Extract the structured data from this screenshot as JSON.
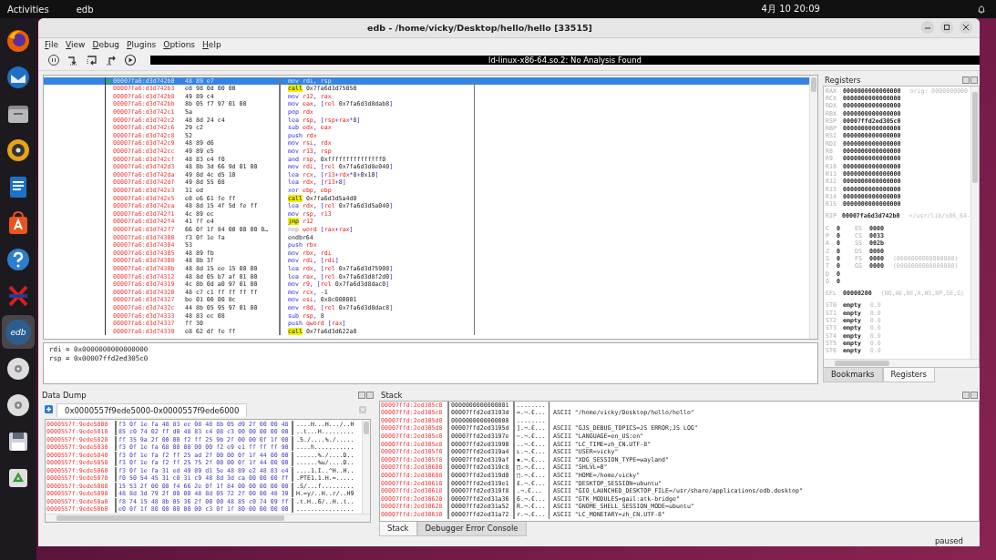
{
  "topbar": {
    "activities": "Activities",
    "app": "edb",
    "clock": "4月 10 20:09"
  },
  "dock": [
    {
      "kind": "browser",
      "active": false
    },
    {
      "kind": "mail",
      "active": false
    },
    {
      "kind": "files",
      "active": false
    },
    {
      "kind": "music",
      "active": false
    },
    {
      "kind": "writer",
      "active": false
    },
    {
      "kind": "store",
      "active": false
    },
    {
      "kind": "help",
      "active": false
    },
    {
      "kind": "cross",
      "active": false
    },
    {
      "kind": "edb",
      "active": true,
      "label": "edb"
    },
    {
      "kind": "disc",
      "active": false
    },
    {
      "kind": "disc",
      "active": false
    },
    {
      "kind": "save",
      "active": false
    },
    {
      "kind": "trash",
      "active": false
    }
  ],
  "window": {
    "title": "edb - /home/vicky/Desktop/hello/hello [33515]"
  },
  "menu": [
    "File",
    "View",
    "Debug",
    "Plugins",
    "Options",
    "Help"
  ],
  "toolbar": {
    "tools": [
      {
        "kind": "pause"
      },
      {
        "kind": "step-into"
      },
      {
        "kind": "step-over"
      },
      {
        "kind": "step-out"
      },
      {
        "kind": "run"
      }
    ],
    "status": "ld-linux-x86-64.so.2: No Analysis Found"
  },
  "disassembly": {
    "rows": [
      {
        "address": "00007fa6:d3d742b0",
        "bytes": "48 89 e7",
        "mnemonic": "mov",
        "operands": "rdi, rsp",
        "kind": "normal",
        "selected": true
      },
      {
        "address": "00007fa6:d3d742b3",
        "bytes": "e8 98 0d 00 00",
        "mnemonic": "call",
        "operands": "0x7fa6d3d75050",
        "kind": "call",
        "selected": false
      },
      {
        "address": "00007fa6:d3d742b8",
        "bytes": "49 89 c4",
        "mnemonic": "mov",
        "operands": "r12, rax",
        "kind": "normal",
        "selected": false
      },
      {
        "address": "00007fa6:d3d742bb",
        "bytes": "8b 05 f7 97 01 00",
        "mnemonic": "mov",
        "operands": "eax, [rel 0x7fa6d3d8dab8]",
        "kind": "normal",
        "selected": false
      },
      {
        "address": "00007fa6:d3d742c1",
        "bytes": "5a",
        "mnemonic": "pop",
        "operands": "rdx",
        "kind": "normal",
        "selected": false
      },
      {
        "address": "00007fa6:d3d742c2",
        "bytes": "48 8d 24 c4",
        "mnemonic": "lea",
        "operands": "rsp, [rsp+rax*8]",
        "kind": "normal",
        "selected": false
      },
      {
        "address": "00007fa6:d3d742c6",
        "bytes": "29 c2",
        "mnemonic": "sub",
        "operands": "edx, eax",
        "kind": "normal",
        "selected": false
      },
      {
        "address": "00007fa6:d3d742c8",
        "bytes": "52",
        "mnemonic": "push",
        "operands": "rdx",
        "kind": "normal",
        "selected": false
      },
      {
        "address": "00007fa6:d3d742c9",
        "bytes": "48 89 d6",
        "mnemonic": "mov",
        "operands": "rsi, rdx",
        "kind": "normal",
        "selected": false
      },
      {
        "address": "00007fa6:d3d742cc",
        "bytes": "49 89 e5",
        "mnemonic": "mov",
        "operands": "r13, rsp",
        "kind": "normal",
        "selected": false
      },
      {
        "address": "00007fa6:d3d742cf",
        "bytes": "48 83 e4 f0",
        "mnemonic": "and",
        "operands": "rsp, 0xfffffffffffffff0",
        "kind": "normal",
        "selected": false
      },
      {
        "address": "00007fa6:d3d742d3",
        "bytes": "48 8b 3d 66 9d 01 00",
        "mnemonic": "mov",
        "operands": "rdi, [rel 0x7fa6d3d8e040]",
        "kind": "normal",
        "selected": false
      },
      {
        "address": "00007fa6:d3d742da",
        "bytes": "49 8d 4c d5 10",
        "mnemonic": "lea",
        "operands": "rcx, [r13+rdx*8+0x10]",
        "kind": "normal",
        "selected": false
      },
      {
        "address": "00007fa6:d3d742df",
        "bytes": "49 8d 55 08",
        "mnemonic": "lea",
        "operands": "rdx, [r13+8]",
        "kind": "normal",
        "selected": false
      },
      {
        "address": "00007fa6:d3d742e3",
        "bytes": "31 ed",
        "mnemonic": "xor",
        "operands": "ebp, ebp",
        "kind": "normal",
        "selected": false
      },
      {
        "address": "00007fa6:d3d742e5",
        "bytes": "e8 e6 61 fe ff",
        "mnemonic": "call",
        "operands": "0x7fa6d3d5a4d0",
        "kind": "call",
        "selected": false
      },
      {
        "address": "00007fa6:d3d742ea",
        "bytes": "48 8d 15 4f 5d fe ff",
        "mnemonic": "lea",
        "operands": "rdx, [rel 0x7fa6d3d5a040]",
        "kind": "normal",
        "selected": false
      },
      {
        "address": "00007fa6:d3d742f1",
        "bytes": "4c 89 ec",
        "mnemonic": "mov",
        "operands": "rsp, r13",
        "kind": "normal",
        "selected": false
      },
      {
        "address": "00007fa6:d3d742f4",
        "bytes": "41 ff e4",
        "mnemonic": "jmp",
        "operands": "r12",
        "kind": "call",
        "selected": false
      },
      {
        "address": "00007fa6:d3d742f7",
        "bytes": "66 0f 1f 84 00 00 00 0…",
        "mnemonic": "nop",
        "operands": "word [rax+rax]",
        "kind": "nop",
        "selected": false
      },
      {
        "address": "00007fa6:d3d74300",
        "bytes": "f3 0f 1e fa",
        "mnemonic": "endbr64",
        "operands": "",
        "kind": "plain",
        "selected": false
      },
      {
        "address": "00007fa6:d3d74304",
        "bytes": "53",
        "mnemonic": "push",
        "operands": "rbx",
        "kind": "normal",
        "selected": false
      },
      {
        "address": "00007fa6:d3d74305",
        "bytes": "48 89 fb",
        "mnemonic": "mov",
        "operands": "rbx, rdi",
        "kind": "normal",
        "selected": false
      },
      {
        "address": "00007fa6:d3d74308",
        "bytes": "48 8b 3f",
        "mnemonic": "mov",
        "operands": "rdi, [rdi]",
        "kind": "normal",
        "selected": false
      },
      {
        "address": "00007fa6:d3d7430b",
        "bytes": "48 8d 15 ee 15 00 00",
        "mnemonic": "lea",
        "operands": "rdx, [rel 0x7fa6d3d75900]",
        "kind": "normal",
        "selected": false
      },
      {
        "address": "00007fa6:d3d74312",
        "bytes": "48 8d 05 b7 af 01 00",
        "mnemonic": "lea",
        "operands": "rax, [rel 0x7fa6d3d8f2d0]",
        "kind": "normal",
        "selected": false
      },
      {
        "address": "00007fa6:d3d74319",
        "bytes": "4c 8b 0d a0 97 01 00",
        "mnemonic": "mov",
        "operands": "r9, [rel 0x7fa6d3d8dac0]",
        "kind": "normal",
        "selected": false
      },
      {
        "address": "00007fa6:d3d74320",
        "bytes": "48 c7 c1 ff ff ff ff",
        "mnemonic": "mov",
        "operands": "rcx, -1",
        "kind": "normal",
        "selected": false
      },
      {
        "address": "00007fa6:d3d74327",
        "bytes": "be 01 00 00 8c",
        "mnemonic": "mov",
        "operands": "esi, 0x8c000001",
        "kind": "normal",
        "selected": false
      },
      {
        "address": "00007fa6:d3d7432c",
        "bytes": "44 8b 05 95 97 01 00",
        "mnemonic": "mov",
        "operands": "r8d, [rel 0x7fa6d3d8dac8]",
        "kind": "normal",
        "selected": false
      },
      {
        "address": "00007fa6:d3d74333",
        "bytes": "48 83 ec 08",
        "mnemonic": "sub",
        "operands": "rsp, 8",
        "kind": "normal",
        "selected": false
      },
      {
        "address": "00007fa6:d3d74337",
        "bytes": "ff 30",
        "mnemonic": "push",
        "operands": "qword [rax]",
        "kind": "normal",
        "selected": false
      },
      {
        "address": "00007fa6:d3d74339",
        "bytes": "e8 62 df fe ff",
        "mnemonic": "call",
        "operands": "0x7fa6d3d622a0",
        "kind": "call",
        "selected": false
      }
    ]
  },
  "info": [
    "rdi = 0x0000000000000000",
    "rsp = 0x00007ffd2ed305c0"
  ],
  "registers": {
    "title": "Registers",
    "general": [
      {
        "name": "RAX",
        "value": "0000000000000000",
        "comment": "orig: 0000000000"
      },
      {
        "name": "RCX",
        "value": "0000000000000000"
      },
      {
        "name": "RDX",
        "value": "0000000000000000"
      },
      {
        "name": "RBX",
        "value": "0000000000000000"
      },
      {
        "name": "RSP",
        "value": "00007ffd2ed305c0"
      },
      {
        "name": "RBP",
        "value": "0000000000000000"
      },
      {
        "name": "RSI",
        "value": "0000000000000000"
      },
      {
        "name": "RDI",
        "value": "0000000000000000"
      },
      {
        "name": "R8",
        "value": "0000000000000000"
      },
      {
        "name": "R9",
        "value": "0000000000000000"
      },
      {
        "name": "R10",
        "value": "0000000000000000"
      },
      {
        "name": "R11",
        "value": "0000000000000000"
      },
      {
        "name": "R12",
        "value": "0000000000000000"
      },
      {
        "name": "R13",
        "value": "0000000000000000"
      },
      {
        "name": "R14",
        "value": "0000000000000000"
      },
      {
        "name": "R15",
        "value": "0000000000000000"
      }
    ],
    "rip": {
      "name": "RIP",
      "value": "00007fa6d3d742b0",
      "comment": "</usr/lib/x86_64-"
    },
    "flags": [
      {
        "flag": "C",
        "value": "0",
        "segment": "ES",
        "segment_value": "0000"
      },
      {
        "flag": "P",
        "value": "0",
        "segment": "CS",
        "segment_value": "0033"
      },
      {
        "flag": "A",
        "value": "0",
        "segment": "SS",
        "segment_value": "002b"
      },
      {
        "flag": "Z",
        "value": "0",
        "segment": "DS",
        "segment_value": "0000"
      },
      {
        "flag": "S",
        "value": "0",
        "segment": "FS",
        "segment_value": "0000",
        "comment": "(0000000000000000)"
      },
      {
        "flag": "T",
        "value": "0",
        "segment": "GS",
        "segment_value": "0000",
        "comment": "(0000000000000000)"
      },
      {
        "flag": "D",
        "value": "0"
      },
      {
        "flag": "O",
        "value": "0"
      }
    ],
    "efl": {
      "name": "EFL",
      "value": "00000200",
      "comment": "(NO,AE,NE,A,NS,NP,GE,G)"
    },
    "fpu": [
      {
        "name": "ST0",
        "value": "empty",
        "comment": "0.0"
      },
      {
        "name": "ST1",
        "value": "empty",
        "comment": "0.0"
      },
      {
        "name": "ST2",
        "value": "empty",
        "comment": "0.0"
      },
      {
        "name": "ST3",
        "value": "empty",
        "comment": "0.0"
      },
      {
        "name": "ST4",
        "value": "empty",
        "comment": "0.0"
      },
      {
        "name": "ST5",
        "value": "empty",
        "comment": "0.0"
      },
      {
        "name": "ST6",
        "value": "empty",
        "comment": "0.0"
      }
    ],
    "tabs": [
      {
        "label": "Bookmarks",
        "selected": false
      },
      {
        "label": "Registers",
        "selected": true
      }
    ]
  },
  "data_dump": {
    "title": "Data Dump",
    "tab": "0x0000557f9ede5000-0x0000557f9ede6000",
    "rows": [
      {
        "address": "0000557f:9ede5000",
        "hex": "f3 0f 1e fa 48 83 ec 08 48 8b 05 d9 2f 00 00 48",
        "ascii": "....H...H.../..H"
      },
      {
        "address": "0000557f:9ede5010",
        "hex": "85 c0 74 02 ff d0 48 83 c4 08 c3 00 00 00 00 00",
        "ascii": "..t...H........."
      },
      {
        "address": "0000557f:9ede5020",
        "hex": "ff 35 9a 2f 00 00 f2 ff 25 9b 2f 00 00 0f 1f 00",
        "ascii": ".5./....%./....."
      },
      {
        "address": "0000557f:9ede5030",
        "hex": "f3 0f 1e fa 68 00 00 00 00 f2 e9 e1 ff ff ff 90",
        "ascii": "....h..........."
      },
      {
        "address": "0000557f:9ede5040",
        "hex": "f3 0f 1e fa f2 ff 25 ad 2f 00 00 0f 1f 44 00 00",
        "ascii": "......%./....D.."
      },
      {
        "address": "0000557f:9ede5050",
        "hex": "f3 0f 1e fa f2 ff 25 75 2f 00 00 0f 1f 44 00 00",
        "ascii": "......%u/....D.."
      },
      {
        "address": "0000557f:9ede5060",
        "hex": "f3 0f 1e fa 31 ed 49 89 d1 5e 48 89 e2 48 83 e4",
        "ascii": "....1.I..^H..H.."
      },
      {
        "address": "0000557f:9ede5070",
        "hex": "f0 50 54 45 31 c0 31 c9 48 8d 3d ca 00 00 00 ff",
        "ascii": ".PTE1.1.H.=....."
      },
      {
        "address": "0000557f:9ede5080",
        "hex": "15 53 2f 00 00 f4 66 2e 0f 1f 84 00 00 00 00 00",
        "ascii": ".S/...f........."
      },
      {
        "address": "0000557f:9ede5090",
        "hex": "48 8d 3d 79 2f 00 00 48 8d 05 72 2f 00 00 48 39",
        "ascii": "H.=y/..H..r/..H9"
      },
      {
        "address": "0000557f:9ede50a0",
        "hex": "f8 74 15 48 8b 05 36 2f 00 00 48 85 c0 74 09 ff",
        "ascii": ".t.H..6/..H..t.."
      },
      {
        "address": "0000557f:9ede50b0",
        "hex": "e0 0f 1f 80 00 00 00 00 c3 0f 1f 80 00 00 00 00",
        "ascii": "................"
      }
    ]
  },
  "stack": {
    "title": "Stack",
    "rows": [
      {
        "address": "00007ffd:2ed305c0",
        "value": "0000000000000001",
        "ascii": "........",
        "comment": ""
      },
      {
        "address": "00007ffd:2ed305c8",
        "value": "00007ffd2ed3193d",
        "ascii": "=.¬.€...",
        "comment": "ASCII \"/home/vicky/Desktop/hello/hello\""
      },
      {
        "address": "00007ffd:2ed305d0",
        "value": "0000000000000000",
        "ascii": "........",
        "comment": ""
      },
      {
        "address": "00007ffd:2ed305d8",
        "value": "00007ffd2ed3195d",
        "ascii": "].¬.€...",
        "comment": "ASCII \"GJS_DEBUG_TOPICS=JS ERROR;JS LOG\""
      },
      {
        "address": "00007ffd:2ed305e0",
        "value": "00007ffd2ed3197e",
        "ascii": "~.¬.€...",
        "comment": "ASCII \"LANGUAGE=en_US:en\""
      },
      {
        "address": "00007ffd:2ed305e8",
        "value": "00007ffd2ed31990",
        "ascii": "..¬.€...",
        "comment": "ASCII \"LC_TIME=zh_CN.UTF-8\""
      },
      {
        "address": "00007ffd:2ed305f0",
        "value": "00007ffd2ed319a4",
        "ascii": "ʟ.¬.€...",
        "comment": "ASCII \"USER=vicky\""
      },
      {
        "address": "00007ffd:2ed305f8",
        "value": "00007ffd2ed319af",
        "ascii": "▪.¬.€...",
        "comment": "ASCII \"XDG_SESSION_TYPE=wayland\""
      },
      {
        "address": "00007ffd:2ed30600",
        "value": "00007ffd2ed319c8",
        "ascii": "□.¬.€...",
        "comment": "ASCII \"SHLVL=0\""
      },
      {
        "address": "00007ffd:2ed30608",
        "value": "00007ffd2ed319d0",
        "ascii": "□.¬.€...",
        "comment": "ASCII \"HOME=/home/vicky\""
      },
      {
        "address": "00007ffd:2ed30610",
        "value": "00007ffd2ed319e1",
        "ascii": "£.¬.€...",
        "comment": "ASCII \"DESKTOP_SESSION=ubuntu\""
      },
      {
        "address": "00007ffd:2ed30618",
        "value": "00007ffd2ed319f8",
        "ascii": " .¬.€...",
        "comment": "ASCII \"GIO_LAUNCHED_DESKTOP_FILE=/usr/share/applications/edb.desktop\""
      },
      {
        "address": "00007ffd:2ed30620",
        "value": "00007ffd2ed31a36",
        "ascii": "6.¬.€...",
        "comment": "ASCII \"GTK_MODULES=gail:atk-bridge\""
      },
      {
        "address": "00007ffd:2ed30628",
        "value": "00007ffd2ed31a52",
        "ascii": "R.¬.€...",
        "comment": "ASCII \"GNOME_SHELL_SESSION_MODE=ubuntu\""
      },
      {
        "address": "00007ffd:2ed30630",
        "value": "00007ffd2ed31a72",
        "ascii": "r.¬.€...",
        "comment": "ASCII \"LC_MONETARY=zh_CN.UTF-8\""
      }
    ],
    "tabs": [
      {
        "label": "Stack",
        "selected": true
      },
      {
        "label": "Debugger Error Console",
        "selected": false
      }
    ]
  },
  "status": "paused"
}
